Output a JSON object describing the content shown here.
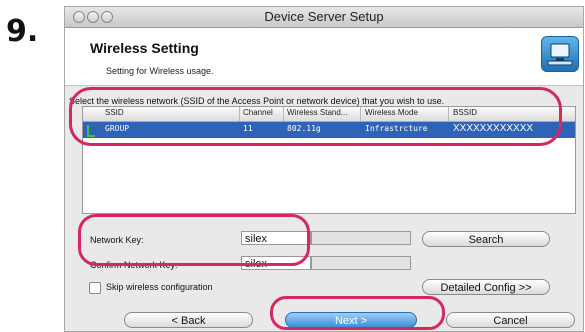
{
  "step": {
    "number": "9."
  },
  "window": {
    "title": "Device Server Setup"
  },
  "header": {
    "title": "Wireless Setting",
    "subtitle": "Setting for Wireless usage.",
    "icon": "network-setup-icon"
  },
  "instruction": "Select the wireless network (SSID of the Access Point or network device) that you wish to use.",
  "table": {
    "columns": [
      "SSID",
      "Channel",
      "Wireless Stand...",
      "Wireless Mode",
      "BSSID"
    ],
    "rows": [
      {
        "ssid": "GROUP",
        "channel": "11",
        "standard": "802.11g",
        "mode": "Infrastrcture",
        "bssid": "XXXXXXXXXXXX"
      }
    ]
  },
  "network_key": {
    "label": "Network Key:",
    "value": "silex"
  },
  "confirm_key": {
    "label": "Confirm Network Key:",
    "value": "silex"
  },
  "skip": {
    "label": "Skip wireless configuration",
    "checked": false
  },
  "buttons": {
    "search": "Search",
    "detailed": "Detailed Config >>",
    "back": "< Back",
    "next": "Next >",
    "cancel": "Cancel"
  },
  "colors": {
    "annotation": "#d6285c",
    "selection": "#2f63b8",
    "signal": "#3fc43f"
  }
}
